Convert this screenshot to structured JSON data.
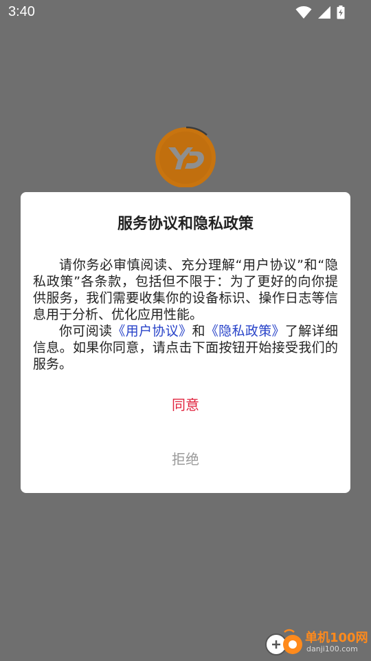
{
  "status_bar": {
    "time": "3:40",
    "icons": [
      "wifi-icon",
      "cell-signal-icon",
      "battery-charging-icon"
    ]
  },
  "background": {
    "logo_icon": "yd-logo-icon",
    "logo_color": "#c8740f"
  },
  "dialog": {
    "title": "服务协议和隐私政策",
    "paragraph1": "请你务必审慎阅读、充分理解“用户协议”和“隐私政策”各条款，包括但不限于：为了更好的向你提供服务，我们需要收集你的设备标识、操作日志等信息用于分析、优化应用性能。",
    "paragraph2": {
      "prefix": "你可阅读",
      "user_agreement_link": "《用户协议》",
      "and": "和",
      "privacy_policy_link": "《隐私政策》",
      "suffix": "了解详细信息。如果你同意，请点击下面按钮开始接受我们的服务。"
    },
    "agree_label": "同意",
    "reject_label": "拒绝",
    "link_color": "#2742c8",
    "agree_color": "#e0213c"
  },
  "watermark": {
    "name": "单机100网",
    "url": "danji100.com"
  }
}
